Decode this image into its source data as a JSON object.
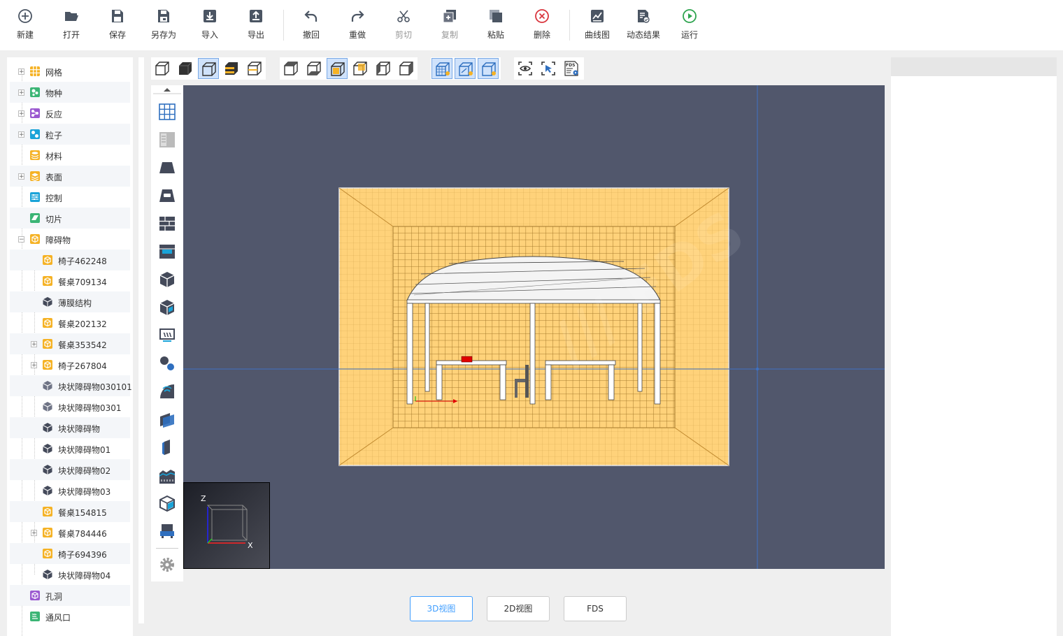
{
  "toolbar": {
    "new": "新建",
    "open": "打开",
    "save": "保存",
    "save_as": "另存为",
    "import": "导入",
    "export": "导出",
    "undo": "撤回",
    "redo": "重做",
    "cut": "剪切",
    "copy": "复制",
    "paste": "粘贴",
    "delete": "删除",
    "chart": "曲线图",
    "dynamic_result": "动态结果",
    "run": "运行"
  },
  "tree": {
    "mesh": "网格",
    "species": "物种",
    "reaction": "反应",
    "particle": "粒子",
    "material": "材料",
    "surface": "表面",
    "control": "控制",
    "slice": "切片",
    "obstruction": "障碍物",
    "obstructions": [
      "椅子462248",
      "餐桌709134",
      "薄膜结构",
      "餐桌202132",
      "餐桌353542",
      "椅子267804",
      "块状障碍物030101",
      "块状障碍物0301",
      "块状障碍物",
      "块状障碍物01",
      "块状障碍物02",
      "块状障碍物03",
      "餐桌154815",
      "餐桌784446",
      "椅子694396",
      "块状障碍物04"
    ],
    "hole": "孔洞",
    "vent": "通风口"
  },
  "axes": {
    "z": "Z",
    "x": "X",
    "fds_icon": "FDS"
  },
  "views": {
    "view3d": "3D视图",
    "view2d": "2D视图",
    "fds": "FDS"
  },
  "colors": {
    "viewport_bg": "#51576c",
    "mesh": "#ffd27a",
    "accent": "#409eff"
  }
}
